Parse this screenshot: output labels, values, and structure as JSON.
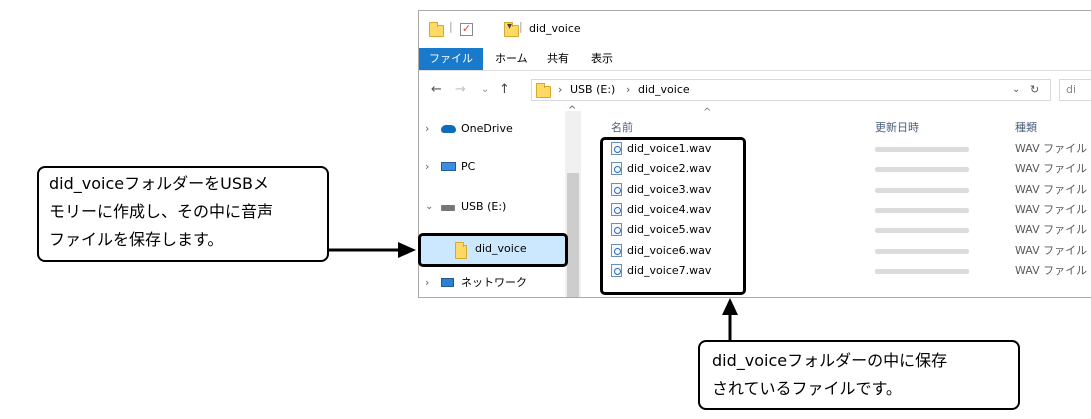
{
  "window": {
    "title": "did_voice",
    "menu": [
      "ファイル",
      "ホーム",
      "共有",
      "表示"
    ],
    "address": [
      "USB (E:)",
      "did_voice"
    ],
    "search_placeholder": "di"
  },
  "nav_pane": {
    "items": [
      {
        "label": "OneDrive",
        "icon": "cloud-icon"
      },
      {
        "label": "PC",
        "icon": "monitor-icon"
      },
      {
        "label": "USB (E:)",
        "icon": "drive-icon"
      },
      {
        "label": "did_voice",
        "icon": "folder-icon",
        "selected": true
      },
      {
        "label": "ネットワーク",
        "icon": "network-icon"
      }
    ]
  },
  "file_list": {
    "columns": [
      "名前",
      "更新日時",
      "種類"
    ],
    "files": [
      {
        "name": "did_voice1.wav",
        "type": "WAV ファイル"
      },
      {
        "name": "did_voice2.wav",
        "type": "WAV ファイル"
      },
      {
        "name": "did_voice3.wav",
        "type": "WAV ファイル"
      },
      {
        "name": "did_voice4.wav",
        "type": "WAV ファイル"
      },
      {
        "name": "did_voice5.wav",
        "type": "WAV ファイル"
      },
      {
        "name": "did_voice6.wav",
        "type": "WAV ファイル"
      },
      {
        "name": "did_voice7.wav",
        "type": "WAV ファイル"
      }
    ]
  },
  "callouts": {
    "left": [
      "did_voiceフォルダーをUSBメ",
      "モリーに作成し、その中に音声",
      "ファイルを保存します。"
    ],
    "bottom": [
      "did_voiceフォルダーの中に保存",
      "されているファイルです。"
    ]
  }
}
